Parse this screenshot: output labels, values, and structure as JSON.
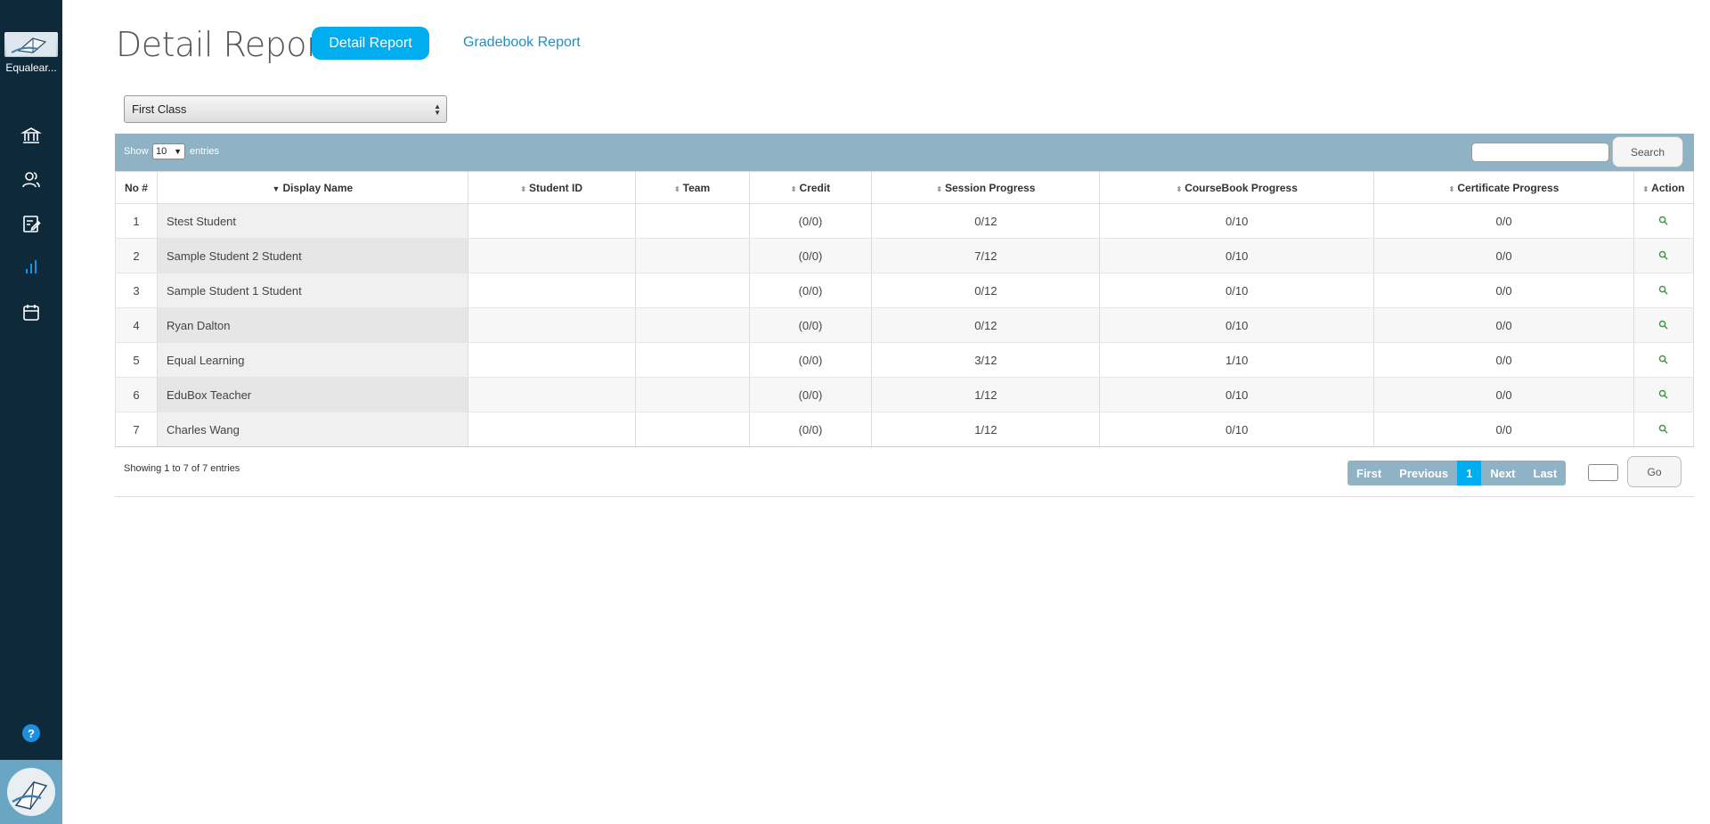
{
  "sidebar": {
    "logo_text": "Equalear...",
    "nav": [
      {
        "icon": "institution-icon",
        "active": false
      },
      {
        "icon": "users-icon",
        "active": false
      },
      {
        "icon": "assignment-icon",
        "active": false
      },
      {
        "icon": "bar-chart-icon",
        "active": true
      },
      {
        "icon": "calendar-icon",
        "active": false
      }
    ],
    "help_label": "?"
  },
  "header": {
    "title": "Detail Report",
    "detail_button": "Detail Report",
    "gradebook_link": "Gradebook Report"
  },
  "class_select": {
    "value": "First Class"
  },
  "toolbar": {
    "show_label": "Show",
    "page_size": "10",
    "entries_label": "entries",
    "search_button": "Search"
  },
  "table": {
    "columns": [
      "No #",
      "Display Name",
      "Student ID",
      "Team",
      "Credit",
      "Session Progress",
      "CourseBook Progress",
      "Certificate Progress",
      "Action"
    ],
    "rows": [
      {
        "no": "1",
        "name": "Stest Student",
        "student_id": "",
        "team": "",
        "credit": "(0/0)",
        "session": "0/12",
        "coursebook": "0/10",
        "certificate": "0/0"
      },
      {
        "no": "2",
        "name": "Sample Student 2 Student",
        "student_id": "",
        "team": "",
        "credit": "(0/0)",
        "session": "7/12",
        "coursebook": "0/10",
        "certificate": "0/0"
      },
      {
        "no": "3",
        "name": "Sample Student 1 Student",
        "student_id": "",
        "team": "",
        "credit": "(0/0)",
        "session": "0/12",
        "coursebook": "0/10",
        "certificate": "0/0"
      },
      {
        "no": "4",
        "name": "Ryan Dalton",
        "student_id": "",
        "team": "",
        "credit": "(0/0)",
        "session": "0/12",
        "coursebook": "0/10",
        "certificate": "0/0"
      },
      {
        "no": "5",
        "name": "Equal Learning",
        "student_id": "",
        "team": "",
        "credit": "(0/0)",
        "session": "3/12",
        "coursebook": "1/10",
        "certificate": "0/0"
      },
      {
        "no": "6",
        "name": "EduBox Teacher",
        "student_id": "",
        "team": "",
        "credit": "(0/0)",
        "session": "1/12",
        "coursebook": "0/10",
        "certificate": "0/0"
      },
      {
        "no": "7",
        "name": "Charles Wang",
        "student_id": "",
        "team": "",
        "credit": "(0/0)",
        "session": "1/12",
        "coursebook": "0/10",
        "certificate": "0/0"
      }
    ]
  },
  "footer": {
    "info_prefix": "Showing ",
    "info_start": "1",
    "info_to": " to ",
    "info_end": "7",
    "info_of": " of ",
    "info_total": "7",
    "info_suffix": " entries",
    "pager": {
      "first": "First",
      "previous": "Previous",
      "current": "1",
      "next": "Next",
      "last": "Last"
    },
    "go_button": "Go"
  },
  "colors": {
    "sidebar_bg": "#0e2a3a",
    "accent": "#00aeef",
    "toolbar_bg": "#8fb3c5",
    "link": "#1e90c8"
  }
}
